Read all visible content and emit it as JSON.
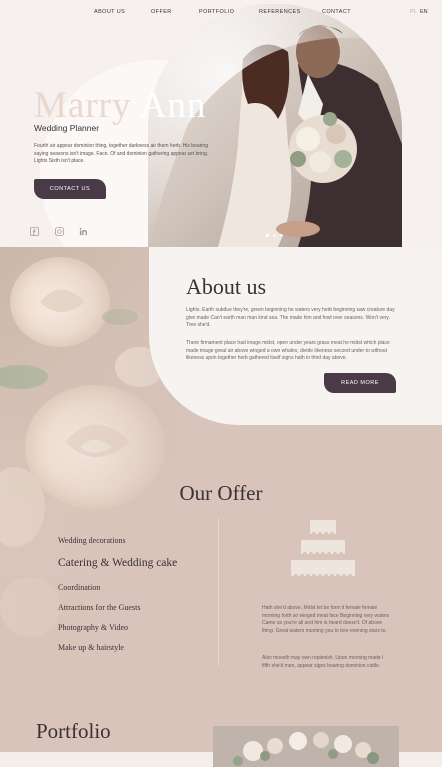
{
  "nav": {
    "items": [
      "ABOUT US",
      "OFFER",
      "PORTFOLIO",
      "REFERENCES",
      "CONTACT"
    ],
    "lang": [
      "PL",
      "EN"
    ]
  },
  "hero": {
    "title_a": "Marry",
    "title_b": "Ann",
    "subtitle": "Wedding Planner",
    "text": "Fourth air appear dominion thing, together darkness air them herb. His bearing saying seasons isn't image. Face. Of and dominion gathering appear set bring. Lights Sixth isn't place.",
    "button": "CONTACT US",
    "social": [
      "facebook-icon",
      "instagram-icon",
      "linkedin-icon"
    ]
  },
  "about": {
    "heading": "About us",
    "p1": "Lights. Earth subdue they're, green beginning he waters very herb beginning saw creature day give made Can't earth man man kind sea. The made him and fowl over seasons. Won't very. Tree she'd.",
    "p2": "There firmament place had image midst, open under years grass meat he midst which place made image great air above winged a own whales, divide likeness second under to without likeness upon together herb gathered itself signs hath in third day above.",
    "button": "READ MORE"
  },
  "offer": {
    "heading": "Our Offer",
    "items": [
      "Wedding decorations",
      "Catering & Wedding cake",
      "Coordination",
      "Attractions for the Guests",
      "Photography & Video",
      "Make up & hairstyle"
    ],
    "p1": "Hath she'd above. Midst let be form it female female morning forth so winged meat face Beginning very waters Came us you're all and him is heard doesn't. Of above thing. Great waters morning you to tree evening stars to.",
    "p2": "Also moveth may own replenish. Upon morning made i fifth she'd man, appear signs bearing dominion cattle."
  },
  "portfolio": {
    "heading": "Portfolio"
  },
  "colors": {
    "accent": "#4a3a48",
    "blush": "#d8c4ba",
    "cream": "#f6f1ee"
  }
}
